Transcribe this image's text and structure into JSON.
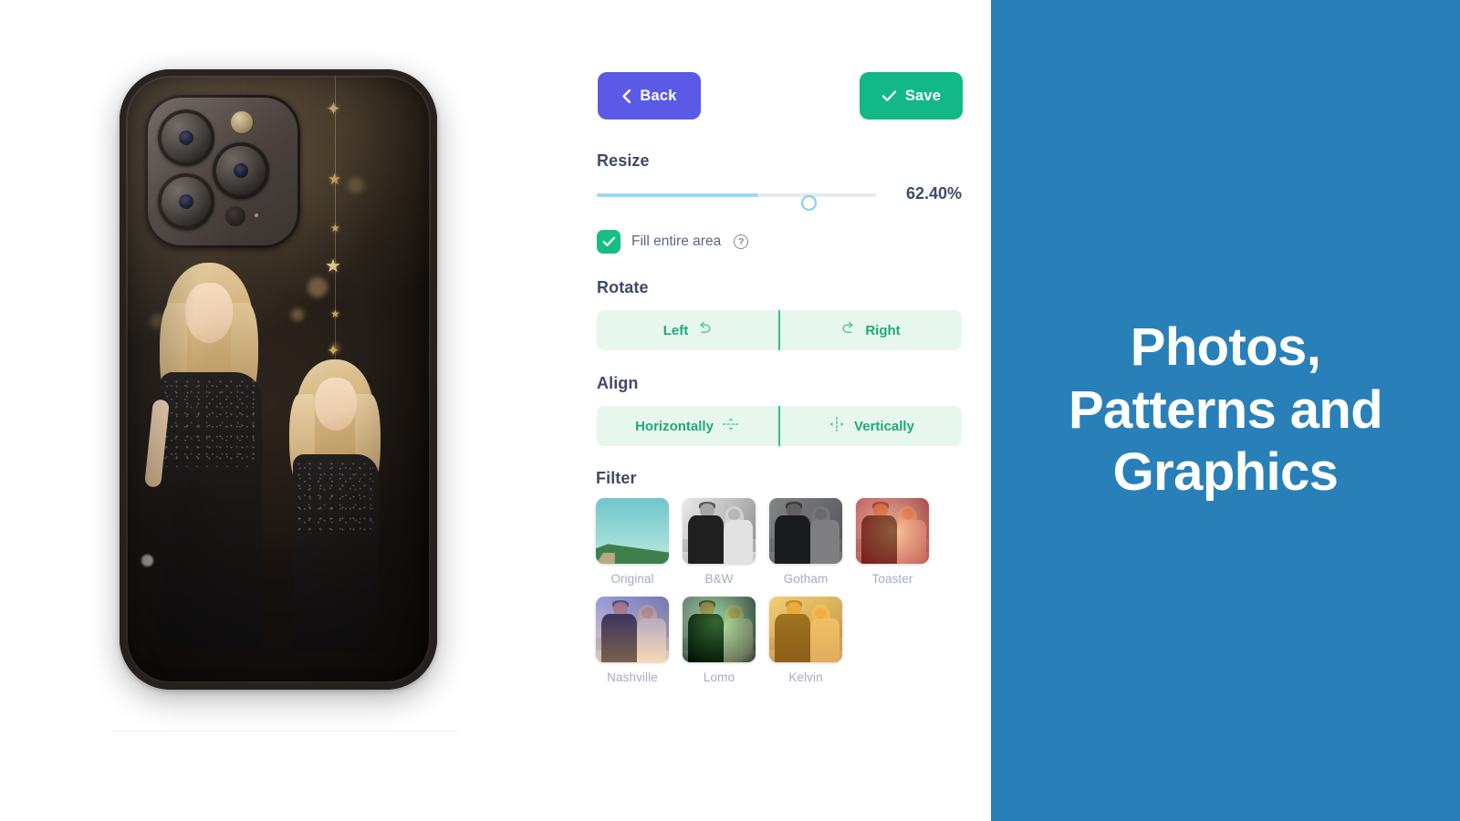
{
  "preview": {
    "product": "phone-case",
    "artwork_description": "Two blonde girls in black dresses on dark backdrop with gold star garland"
  },
  "toolbar": {
    "back_label": "Back",
    "save_label": "Save"
  },
  "resize": {
    "label": "Resize",
    "value_text": "62.40%",
    "value": 62.4,
    "slider_percent": 58
  },
  "fill": {
    "label": "Fill entire area",
    "checked": true,
    "help_glyph": "?"
  },
  "rotate": {
    "label": "Rotate",
    "left_label": "Left",
    "right_label": "Right"
  },
  "align": {
    "label": "Align",
    "horizontal_label": "Horizontally",
    "vertical_label": "Vertically"
  },
  "filter": {
    "label": "Filter",
    "items": [
      {
        "name": "Original"
      },
      {
        "name": "B&W"
      },
      {
        "name": "Gotham"
      },
      {
        "name": "Toaster"
      },
      {
        "name": "Nashville"
      },
      {
        "name": "Lomo"
      },
      {
        "name": "Kelvin"
      }
    ]
  },
  "promo": {
    "line1": "Photos,",
    "line2": "Patterns and",
    "line3": "Graphics"
  },
  "colors": {
    "back_button": "#5A5AE6",
    "save_button": "#12B886",
    "checkbox": "#17BE83",
    "segment_bg": "#E7F7EE",
    "segment_text": "#1FA97A",
    "slider_fill": "#9BD9F7",
    "slider_track": "#E9E9E9",
    "label_text": "#3E4A68",
    "filter_label_text": "#A5ADC2",
    "promo_bg": "#2980B9"
  }
}
